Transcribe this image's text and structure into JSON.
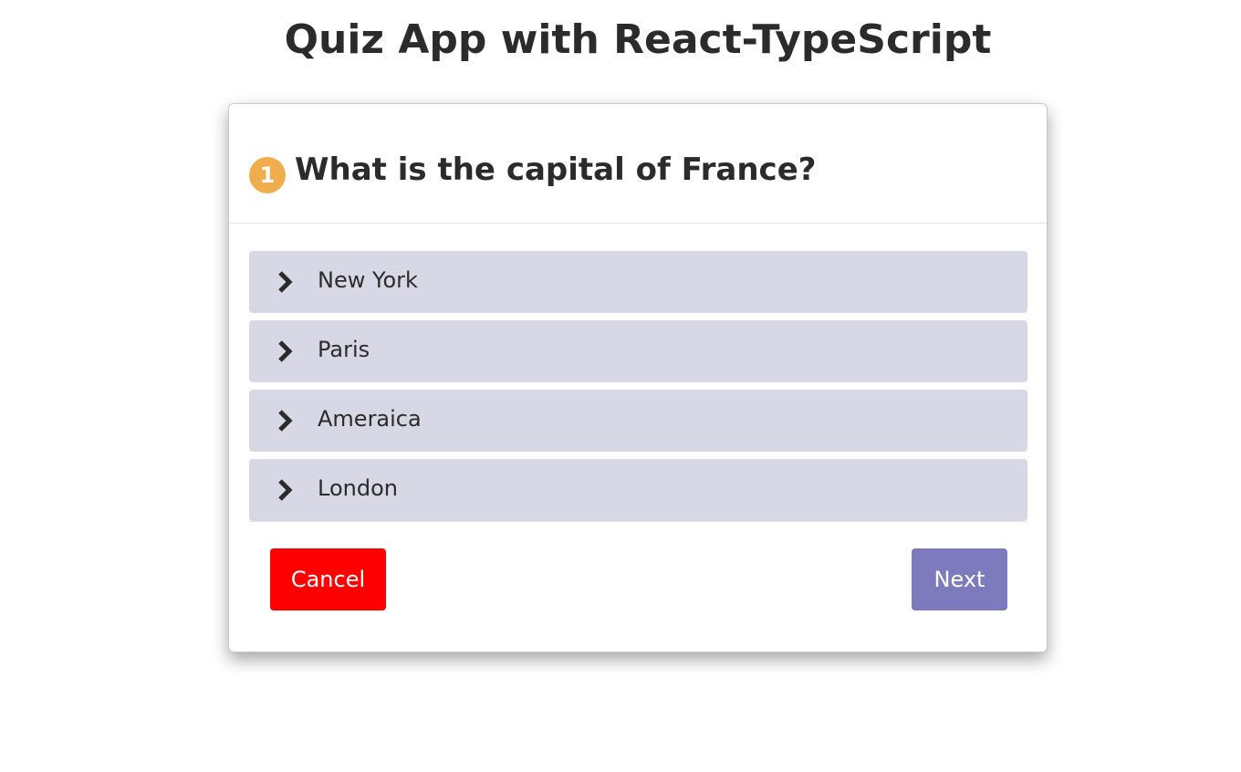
{
  "app": {
    "title": "Quiz App with React-TypeScript"
  },
  "question": {
    "number": "1",
    "text": "What is the capital of France?"
  },
  "options": [
    {
      "label": "New York",
      "icon": "chevron-right-icon"
    },
    {
      "label": "Paris",
      "icon": "chevron-right-icon"
    },
    {
      "label": "Ameraica",
      "icon": "chevron-right-icon"
    },
    {
      "label": "London",
      "icon": "chevron-right-icon"
    }
  ],
  "actions": {
    "cancel_label": "Cancel",
    "next_label": "Next"
  },
  "colors": {
    "badge": "#efad4e",
    "option_bg": "#d8d7e6",
    "cancel": "#ff0000",
    "next": "#7d7bbd"
  }
}
